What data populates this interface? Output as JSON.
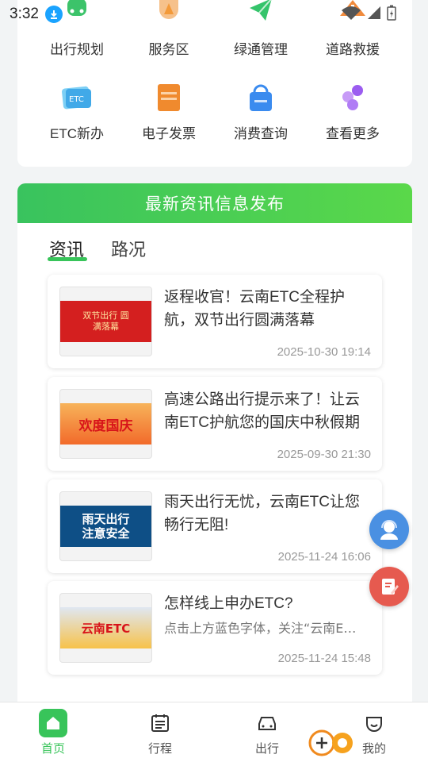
{
  "status_bar": {
    "time": "3:32"
  },
  "services": [
    {
      "label": "出行规划",
      "icon": "route-planning-icon",
      "color": "#3cc36a"
    },
    {
      "label": "服务区",
      "icon": "service-area-icon",
      "color": "#f39a3a"
    },
    {
      "label": "绿通管理",
      "icon": "green-pass-icon",
      "color": "#35c46b"
    },
    {
      "label": "道路救援",
      "icon": "road-rescue-icon",
      "color": "#f08a3c"
    },
    {
      "label": "ETC新办",
      "icon": "etc-card-icon",
      "color": "#41a9e8"
    },
    {
      "label": "电子发票",
      "icon": "invoice-icon",
      "color": "#f08a2e"
    },
    {
      "label": "消费查询",
      "icon": "consumption-query-icon",
      "color": "#3a8bef"
    },
    {
      "label": "查看更多",
      "icon": "more-apps-icon",
      "color": "#9b5cf0"
    }
  ],
  "news_section": {
    "banner": "最新资讯信息发布",
    "tabs": [
      {
        "label": "资讯"
      },
      {
        "label": "路况"
      }
    ],
    "active_tab": "资讯"
  },
  "news": [
    {
      "title": "返程收官！云南ETC全程护航，双节出行圆满落幕",
      "date": "2025-10-30 19:14",
      "thumb_text": "双节出行 圆满落幕",
      "thumb_color": "#d41f1f"
    },
    {
      "title": "高速公路出行提示来了！让云南ETC护航您的国庆中秋假期",
      "date": "2025-09-30 21:30",
      "thumb_text": "欢度国庆",
      "thumb_color": "#f26a2a"
    },
    {
      "title": "雨天出行无忧，云南ETC让您畅行无阻!",
      "date": "2025-11-24 16:06",
      "thumb_text": "雨天出行 注意安全",
      "thumb_color": "#0e4f86"
    },
    {
      "title": "怎样线上申办ETC?",
      "subtitle": "点击上方蓝色字体，关注“云南ETC”",
      "date": "2025-11-24 15:48",
      "thumb_text": "云南ETC",
      "thumb_color": "#f7c24a"
    }
  ],
  "bottom_nav": [
    {
      "label": "首页",
      "icon": "home-icon",
      "active": true
    },
    {
      "label": "行程",
      "icon": "trip-calendar-icon"
    },
    {
      "label": "出行",
      "icon": "car-icon"
    },
    {
      "label": "我的",
      "icon": "profile-icon"
    }
  ],
  "colors": {
    "accent": "#38c45a",
    "banner_green": "#45cc5a",
    "fab_blue": "#4a90e2",
    "fab_red": "#e65a4f"
  }
}
